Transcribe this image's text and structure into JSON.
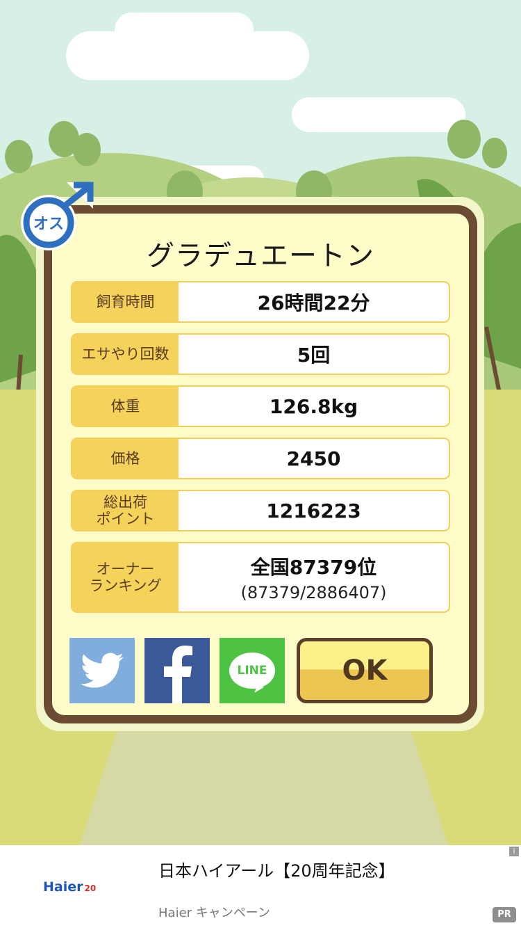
{
  "dialog": {
    "title": "グラデュエートン",
    "gender_badge": {
      "text": "オス",
      "icon": "male-symbol-icon",
      "color": "#2f6fc0"
    },
    "rows": [
      {
        "label": "飼育時間",
        "value": "26時間22分"
      },
      {
        "label": "エサやり回数",
        "value": "5回"
      },
      {
        "label": "体重",
        "value": "126.8kg"
      },
      {
        "label": "価格",
        "value": "2450"
      },
      {
        "label": "総出荷\nポイント",
        "value": "1216223"
      },
      {
        "label": "オーナー\nランキング",
        "value": "全国87379位",
        "sub": "(87379/2886407)"
      }
    ],
    "share": [
      {
        "service": "twitter",
        "icon": "twitter-bird-icon",
        "color": "#7faedd"
      },
      {
        "service": "facebook",
        "icon": "facebook-f-icon",
        "color": "#3b5898"
      },
      {
        "service": "line",
        "icon": "line-logo-icon",
        "text": "LINE",
        "color": "#4ec242"
      }
    ],
    "ok_label": "OK"
  },
  "ad": {
    "logo_text": "Haier",
    "logo_mark": "20",
    "title": "日本ハイアール【20周年記念】",
    "subtitle": "Haier キャンペーン",
    "info_icon": "i",
    "pr_label": "PR"
  },
  "colors": {
    "panel_border": "#6b4c33",
    "panel_fill": "#fefcc8",
    "label_fill": "#f5d25a",
    "ok_top": "#fbf08a",
    "ok_bottom": "#ecc651"
  }
}
